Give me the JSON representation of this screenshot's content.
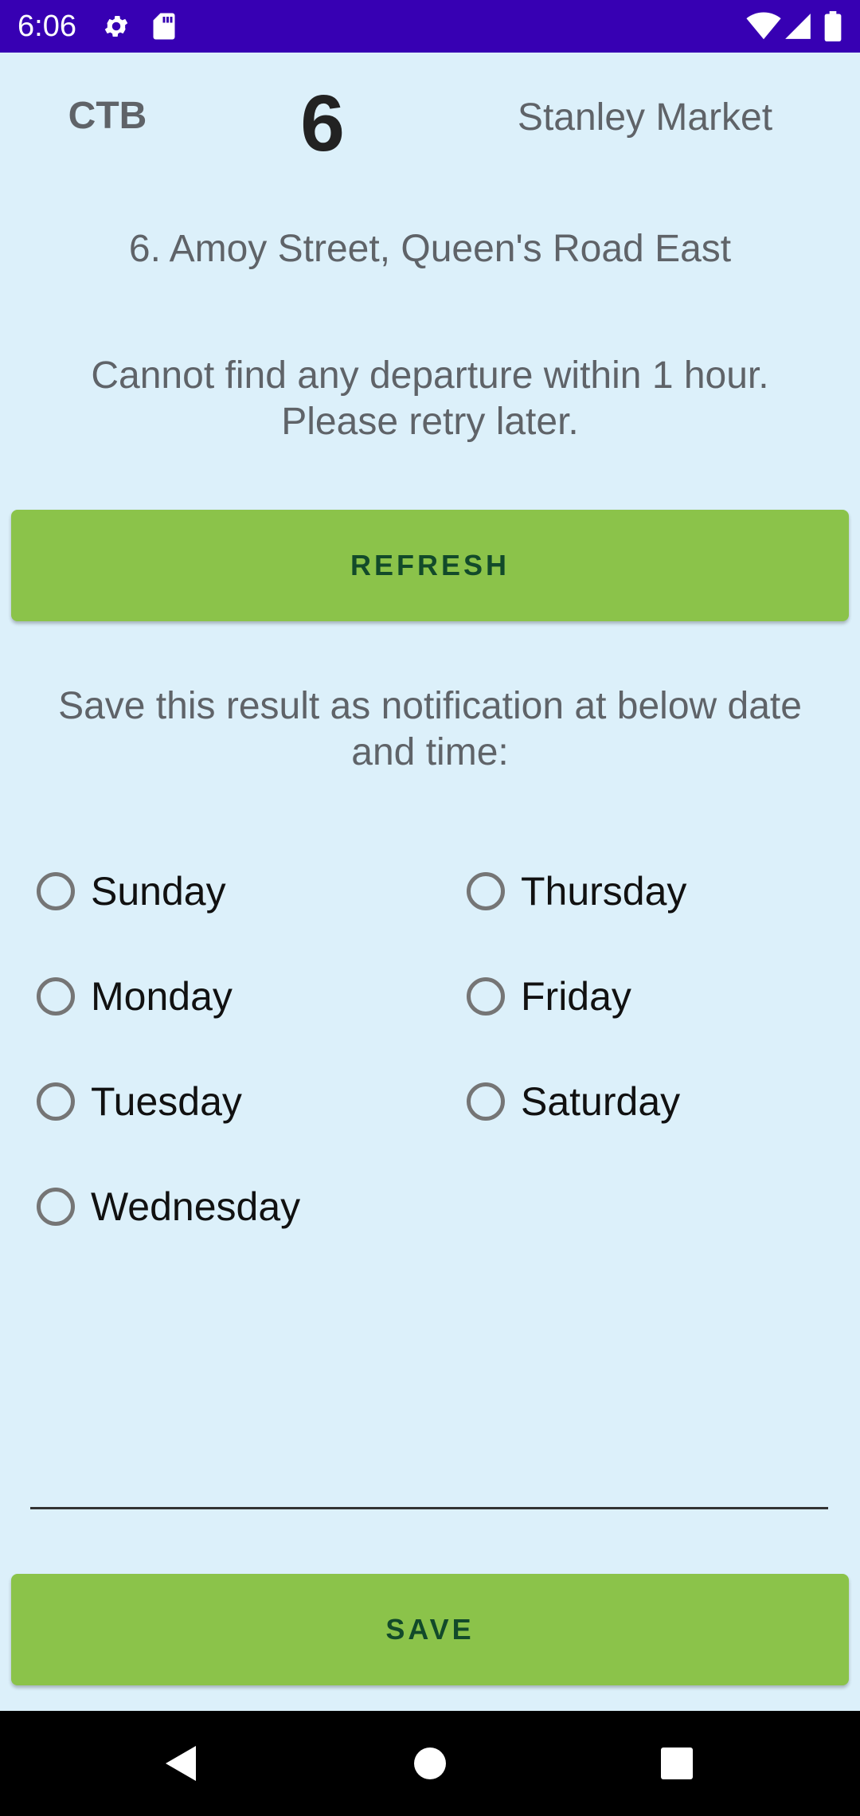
{
  "status_bar": {
    "time": "6:06",
    "icons": [
      "gear-icon",
      "sd-card-icon",
      "wifi-icon",
      "cellular-signal-icon",
      "battery-icon"
    ],
    "background": "#3700B3"
  },
  "route": {
    "operator": "CTB",
    "number": "6",
    "destination": "Stanley Market",
    "stop": "6. Amoy Street, Queen's Road East"
  },
  "message": "Cannot find any departure within 1 hour. Please retry later.",
  "refresh_label": "REFRESH",
  "save_prompt": "Save this result as notification at below date and time:",
  "days": {
    "sunday": "Sunday",
    "monday": "Monday",
    "tuesday": "Tuesday",
    "wednesday": "Wednesday",
    "thursday": "Thursday",
    "friday": "Friday",
    "saturday": "Saturday"
  },
  "save_label": "SAVE",
  "nav": {
    "icons": [
      "back-icon",
      "home-icon",
      "recents-icon"
    ]
  },
  "colors": {
    "background": "#DCF0FA",
    "button": "#8BC34A",
    "button_text": "#124A2A"
  }
}
